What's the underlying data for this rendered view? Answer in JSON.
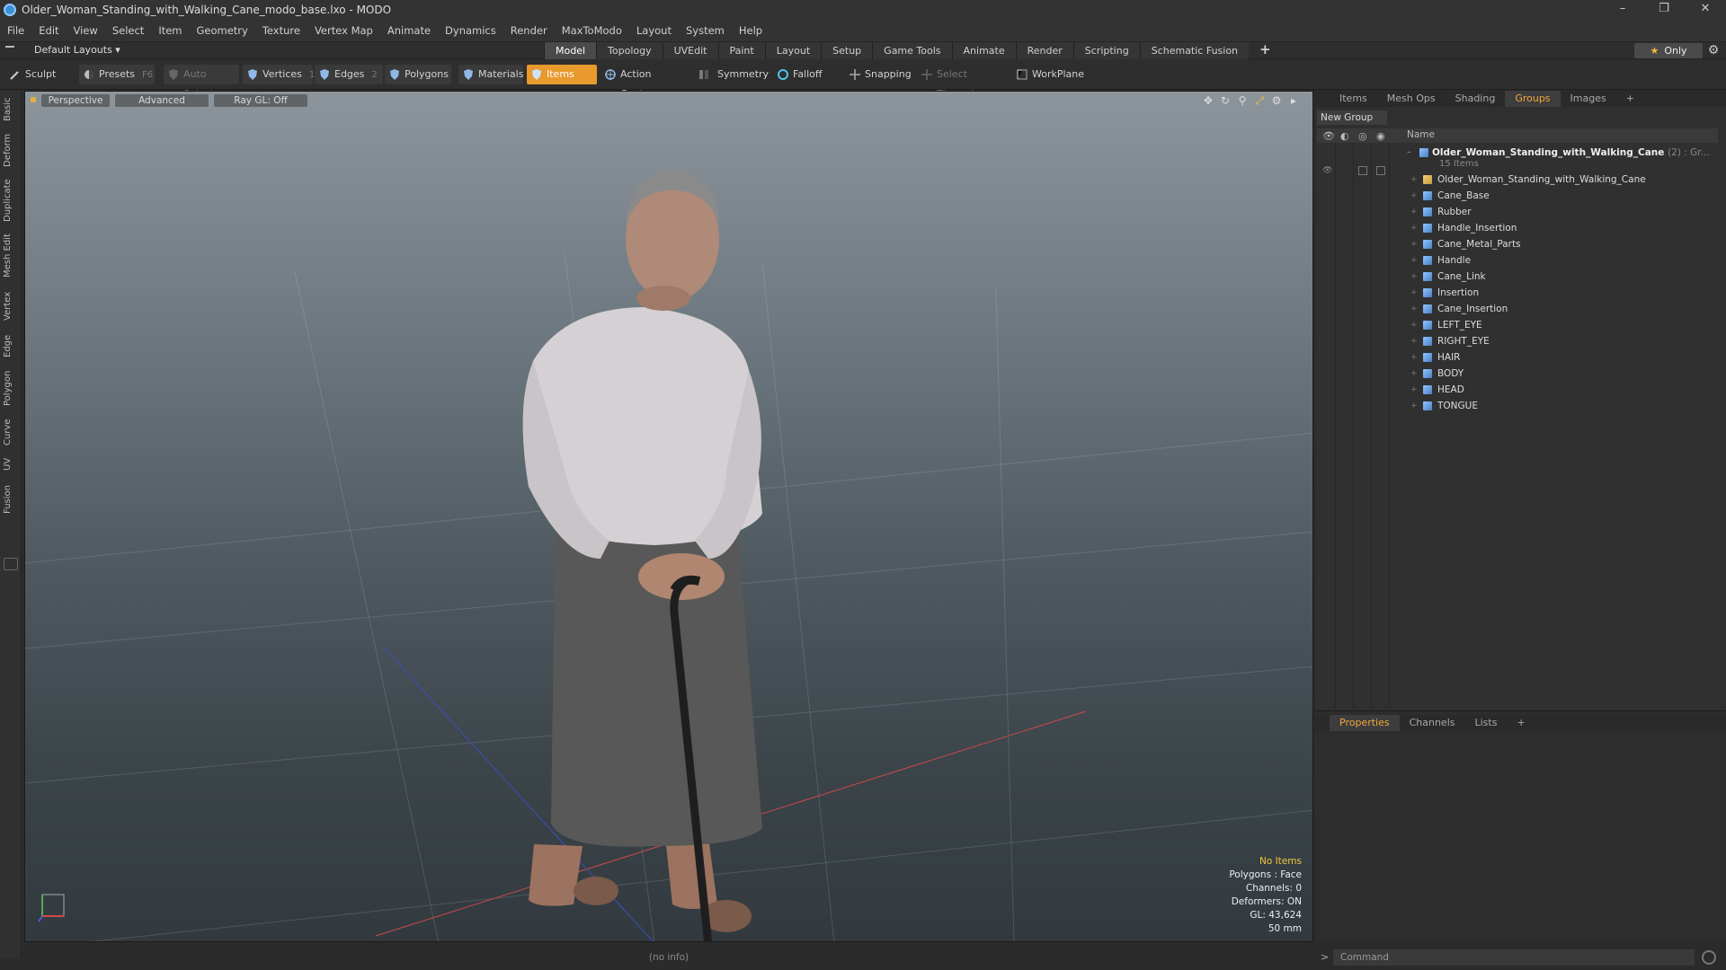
{
  "window": {
    "title": "Older_Woman_Standing_with_Walking_Cane_modo_base.lxo - MODO",
    "min": "–",
    "max": "❐",
    "close": "✕"
  },
  "menu": [
    "File",
    "Edit",
    "View",
    "Select",
    "Item",
    "Geometry",
    "Texture",
    "Vertex Map",
    "Animate",
    "Dynamics",
    "Render",
    "MaxToModo",
    "Layout",
    "System",
    "Help"
  ],
  "layout": {
    "name": "Default Layouts ▾",
    "tabs": [
      "Model",
      "Topology",
      "UVEdit",
      "Paint",
      "Layout",
      "Setup",
      "Game Tools",
      "Animate",
      "Render",
      "Scripting",
      "Schematic Fusion"
    ],
    "active_tab": "Model",
    "plus": "+",
    "only_label": "Only"
  },
  "toolbar": {
    "sculpt": "Sculpt",
    "presets": "Presets",
    "presets_key": "F6",
    "auto_select": "Auto Select",
    "vertices": "Vertices",
    "vertices_key": "1",
    "edges": "Edges",
    "edges_key": "2",
    "polygons": "Polygons",
    "materials": "Materials",
    "items": "Items",
    "action_center": "Action Center",
    "symmetry": "Symmetry",
    "falloff": "Falloff",
    "snapping": "Snapping",
    "select_through": "Select Through",
    "workplane": "WorkPlane"
  },
  "left_tabs": [
    "Basic",
    "Deform",
    "Duplicate",
    "Mesh Edit",
    "Vertex",
    "Edge",
    "Polygon",
    "Curve",
    "UV",
    "Fusion"
  ],
  "viewport": {
    "perspective": "Perspective",
    "advanced": "Advanced",
    "raygl": "Ray GL: Off",
    "stats": {
      "items": "No Items",
      "polygons": "Polygons : Face",
      "channels": "Channels: 0",
      "deformers": "Deformers: ON",
      "gl": "GL: 43,624",
      "focal": "50 mm"
    }
  },
  "status": {
    "info": "(no info)"
  },
  "groups_panel": {
    "tabs": [
      "Items",
      "Mesh Ops",
      "Shading",
      "Groups",
      "Images",
      "+"
    ],
    "active_tab": "Groups",
    "new_group": "New Group",
    "col_name": "Name",
    "group_name": "Older_Woman_Standing_with_Walking_Cane",
    "group_count": "(2) : Gr...",
    "group_sub": "15 Items",
    "items": [
      "Older_Woman_Standing_with_Walking_Cane",
      "Cane_Base",
      "Rubber",
      "Handle_Insertion",
      "Cane_Metal_Parts",
      "Handle",
      "Cane_Link",
      "Insertion",
      "Cane_Insertion",
      "LEFT_EYE",
      "RIGHT_EYE",
      "HAIR",
      "BODY",
      "HEAD",
      "TONGUE"
    ]
  },
  "props_panel": {
    "tabs": [
      "Properties",
      "Channels",
      "Lists",
      "+"
    ],
    "active_tab": "Properties"
  },
  "command": {
    "placeholder": "Command"
  },
  "colors": {
    "accent": "#e89a2c",
    "tab_active": "#f0a83a",
    "stat_highlight": "#f2c53d"
  }
}
